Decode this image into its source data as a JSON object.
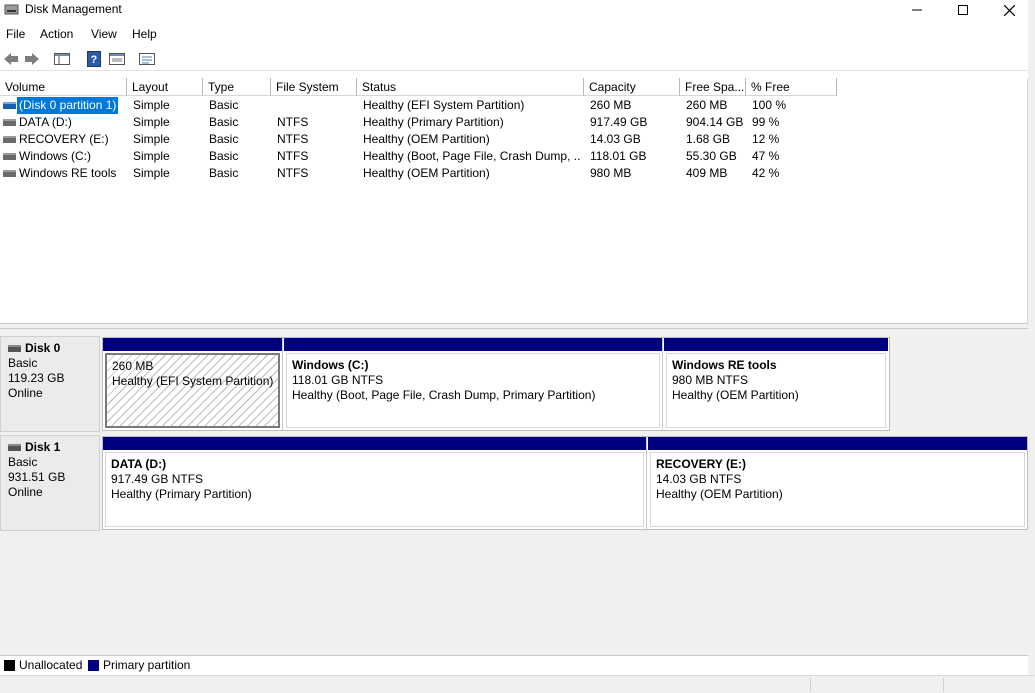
{
  "window": {
    "title": "Disk Management"
  },
  "menu": [
    "File",
    "Action",
    "View",
    "Help"
  ],
  "toolbar": [
    "back-icon",
    "forward-icon",
    "console-tree-icon",
    "help-icon",
    "properties-icon",
    "list-view-icon"
  ],
  "volume_list": {
    "columns": [
      "Volume",
      "Layout",
      "Type",
      "File System",
      "Status",
      "Capacity",
      "Free Spa...",
      "% Free"
    ],
    "rows": [
      {
        "volume": "(Disk 0 partition 1)",
        "layout": "Simple",
        "type": "Basic",
        "fs": "",
        "status": "Healthy (EFI System Partition)",
        "capacity": "260 MB",
        "free": "260 MB",
        "pct": "100 %",
        "selected": true
      },
      {
        "volume": "DATA (D:)",
        "layout": "Simple",
        "type": "Basic",
        "fs": "NTFS",
        "status": "Healthy (Primary Partition)",
        "capacity": "917.49 GB",
        "free": "904.14 GB",
        "pct": "99 %"
      },
      {
        "volume": "RECOVERY (E:)",
        "layout": "Simple",
        "type": "Basic",
        "fs": "NTFS",
        "status": "Healthy (OEM Partition)",
        "capacity": "14.03 GB",
        "free": "1.68 GB",
        "pct": "12 %"
      },
      {
        "volume": "Windows (C:)",
        "layout": "Simple",
        "type": "Basic",
        "fs": "NTFS",
        "status": "Healthy (Boot, Page File, Crash Dump, ...",
        "capacity": "118.01 GB",
        "free": "55.30 GB",
        "pct": "47 %"
      },
      {
        "volume": "Windows RE tools",
        "layout": "Simple",
        "type": "Basic",
        "fs": "NTFS",
        "status": "Healthy (OEM Partition)",
        "capacity": "980 MB",
        "free": "409 MB",
        "pct": "42 %"
      }
    ]
  },
  "disks": [
    {
      "name": "Disk 0",
      "type": "Basic",
      "size": "119.23 GB",
      "state": "Online",
      "partitions": [
        {
          "name": "",
          "size": "260 MB",
          "status": "Healthy (EFI System Partition)",
          "selected": true
        },
        {
          "name": "Windows  (C:)",
          "size": "118.01 GB NTFS",
          "status": "Healthy (Boot, Page File, Crash Dump, Primary Partition)"
        },
        {
          "name": "Windows RE tools",
          "size": "980 MB NTFS",
          "status": "Healthy (OEM Partition)"
        }
      ]
    },
    {
      "name": "Disk 1",
      "type": "Basic",
      "size": "931.51 GB",
      "state": "Online",
      "partitions": [
        {
          "name": "DATA  (D:)",
          "size": "917.49 GB NTFS",
          "status": "Healthy (Primary Partition)"
        },
        {
          "name": "RECOVERY  (E:)",
          "size": "14.03 GB NTFS",
          "status": "Healthy (OEM Partition)"
        }
      ]
    }
  ],
  "legend": [
    {
      "label": "Unallocated",
      "color": "#000000"
    },
    {
      "label": "Primary partition",
      "color": "#000080"
    }
  ],
  "colors": {
    "partition_bar": "#000080",
    "selection": "#0078d7"
  }
}
